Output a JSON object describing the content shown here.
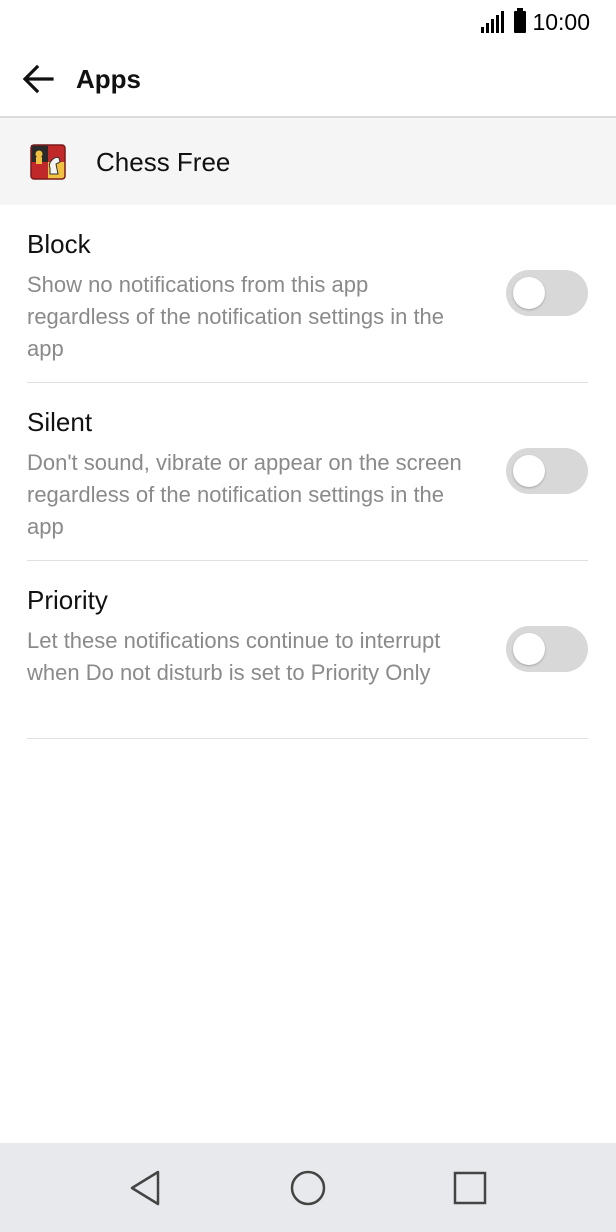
{
  "status_bar": {
    "time": "10:00",
    "icons": [
      "signal-icon",
      "battery-icon"
    ]
  },
  "app_bar": {
    "title": "Apps",
    "back_icon": "arrow-left-icon"
  },
  "app_header": {
    "name": "Chess Free",
    "icon": "chess-app-icon"
  },
  "settings": [
    {
      "title": "Block",
      "description": "Show no notifications from this app regardless of the notification settings in the app",
      "enabled": false
    },
    {
      "title": "Silent",
      "description": "Don't sound, vibrate or appear on the screen regardless of the notification settings in the app",
      "enabled": false
    },
    {
      "title": "Priority",
      "description": "Let these notifications continue to interrupt when Do not disturb is set to Priority Only",
      "enabled": false
    }
  ],
  "nav_bar": {
    "icons": [
      "back-triangle-icon",
      "home-circle-icon",
      "recents-square-icon"
    ]
  },
  "colors": {
    "toggle_off": "#d8d8d8",
    "description_text": "#8a8a8a",
    "header_background": "#f5f5f5",
    "nav_background": "#e8e9ec"
  }
}
